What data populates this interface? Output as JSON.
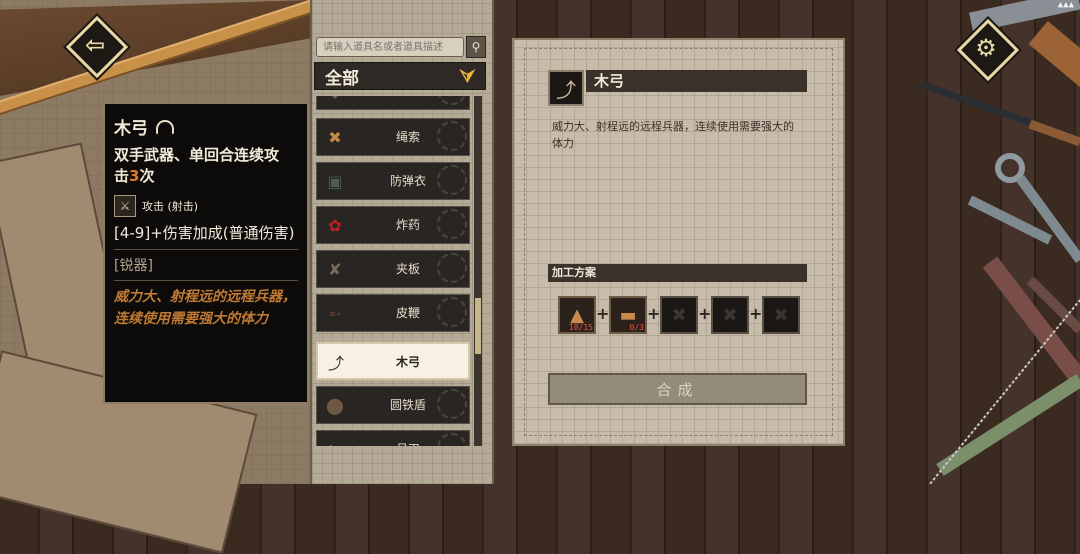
{
  "status_bar": {
    "text": "▲▲▲"
  },
  "nav": {
    "back_glyph": "⇦",
    "settings_glyph": "⚙"
  },
  "tooltip": {
    "name": "木弓",
    "line1": "双手武器、单回合连续攻",
    "line2_prefix": "击",
    "line2_num": "3",
    "line2_suffix": "次",
    "attack_icon": "sword-icon",
    "attack_label": "攻击 (射击)",
    "damage": "[4-9]+伤害加成(普通伤害)",
    "tag": "[锐器]",
    "desc": "威力大、射程远的远程兵器，连续使用需要强大的体力"
  },
  "search": {
    "placeholder": "请输入道具名或者道具描述",
    "value": ""
  },
  "category": {
    "label": "全部"
  },
  "items": [
    {
      "label": "绳索",
      "icon": "rope-icon"
    },
    {
      "label": "防弹衣",
      "icon": "vest-icon"
    },
    {
      "label": "炸药",
      "icon": "bomb-icon"
    },
    {
      "label": "夹板",
      "icon": "splint-icon"
    },
    {
      "label": "皮鞭",
      "icon": "whip-icon"
    },
    {
      "label": "木弓",
      "icon": "bow-icon"
    },
    {
      "label": "圆铁盾",
      "icon": "shield-icon"
    },
    {
      "label": "月刃",
      "icon": "blade-icon"
    }
  ],
  "detail": {
    "name": "木弓",
    "description": "威力大、射程远的远程兵器，连续使用需要强大的体力",
    "recipe_title": "加工方案",
    "materials": [
      {
        "name": "wood-material",
        "qty": "10/15"
      },
      {
        "name": "plank-material",
        "qty": "0/3"
      },
      {
        "name": "empty-slot",
        "qty": ""
      },
      {
        "name": "empty-slot",
        "qty": ""
      },
      {
        "name": "empty-slot",
        "qty": ""
      }
    ],
    "craft_label": "合成"
  },
  "colors": {
    "accent": "#e4b53a",
    "tooltip_desc": "#c07a33",
    "qty_warning": "#ff4b3a",
    "number_highlight": "#e07a2a"
  }
}
